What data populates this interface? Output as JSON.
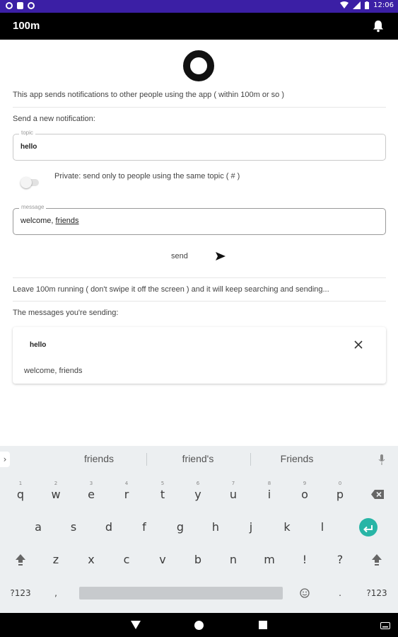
{
  "status_bar": {
    "time": "12:06"
  },
  "app": {
    "title": "100m",
    "intro": "This app sends notifications to other people using the app ( within 100m or so )",
    "new_notification_label": "Send a new notification:",
    "topic": {
      "legend": "topic",
      "value": "hello"
    },
    "private_label": "Private: send only to people using the same topic ( # )",
    "message": {
      "legend": "message",
      "value_prefix": "welcome, ",
      "value_underlined": "friends"
    },
    "send_label": "send",
    "keep_running_note": "Leave 100m running ( don't swipe it off the screen ) and it will keep searching and sending...",
    "sending_label": "The messages you're sending:",
    "sending_items": [
      {
        "topic": "hello",
        "message": "welcome, friends"
      }
    ]
  },
  "keyboard": {
    "suggestions": [
      "friends",
      "friend's",
      "Friends"
    ],
    "row1": [
      {
        "key": "q",
        "hint": "1"
      },
      {
        "key": "w",
        "hint": "2"
      },
      {
        "key": "e",
        "hint": "3"
      },
      {
        "key": "r",
        "hint": "4"
      },
      {
        "key": "t",
        "hint": "5"
      },
      {
        "key": "y",
        "hint": "6"
      },
      {
        "key": "u",
        "hint": "7"
      },
      {
        "key": "i",
        "hint": "8"
      },
      {
        "key": "o",
        "hint": "9"
      },
      {
        "key": "p",
        "hint": "0"
      }
    ],
    "row2": [
      "a",
      "s",
      "d",
      "f",
      "g",
      "h",
      "j",
      "k",
      "l"
    ],
    "row3": [
      "z",
      "x",
      "c",
      "v",
      "b",
      "n",
      "m",
      "!",
      "?"
    ],
    "symbols_label": "?123",
    "comma": ",",
    "period": "."
  },
  "colors": {
    "status_bar": "#3b1fa5",
    "app_bar": "#000000",
    "enter_key": "#28b5a6"
  },
  "icons": [
    "notification-bell-icon",
    "send-arrow-icon",
    "close-icon",
    "microphone-icon",
    "backspace-icon",
    "enter-icon",
    "shift-icon",
    "emoji-icon"
  ]
}
